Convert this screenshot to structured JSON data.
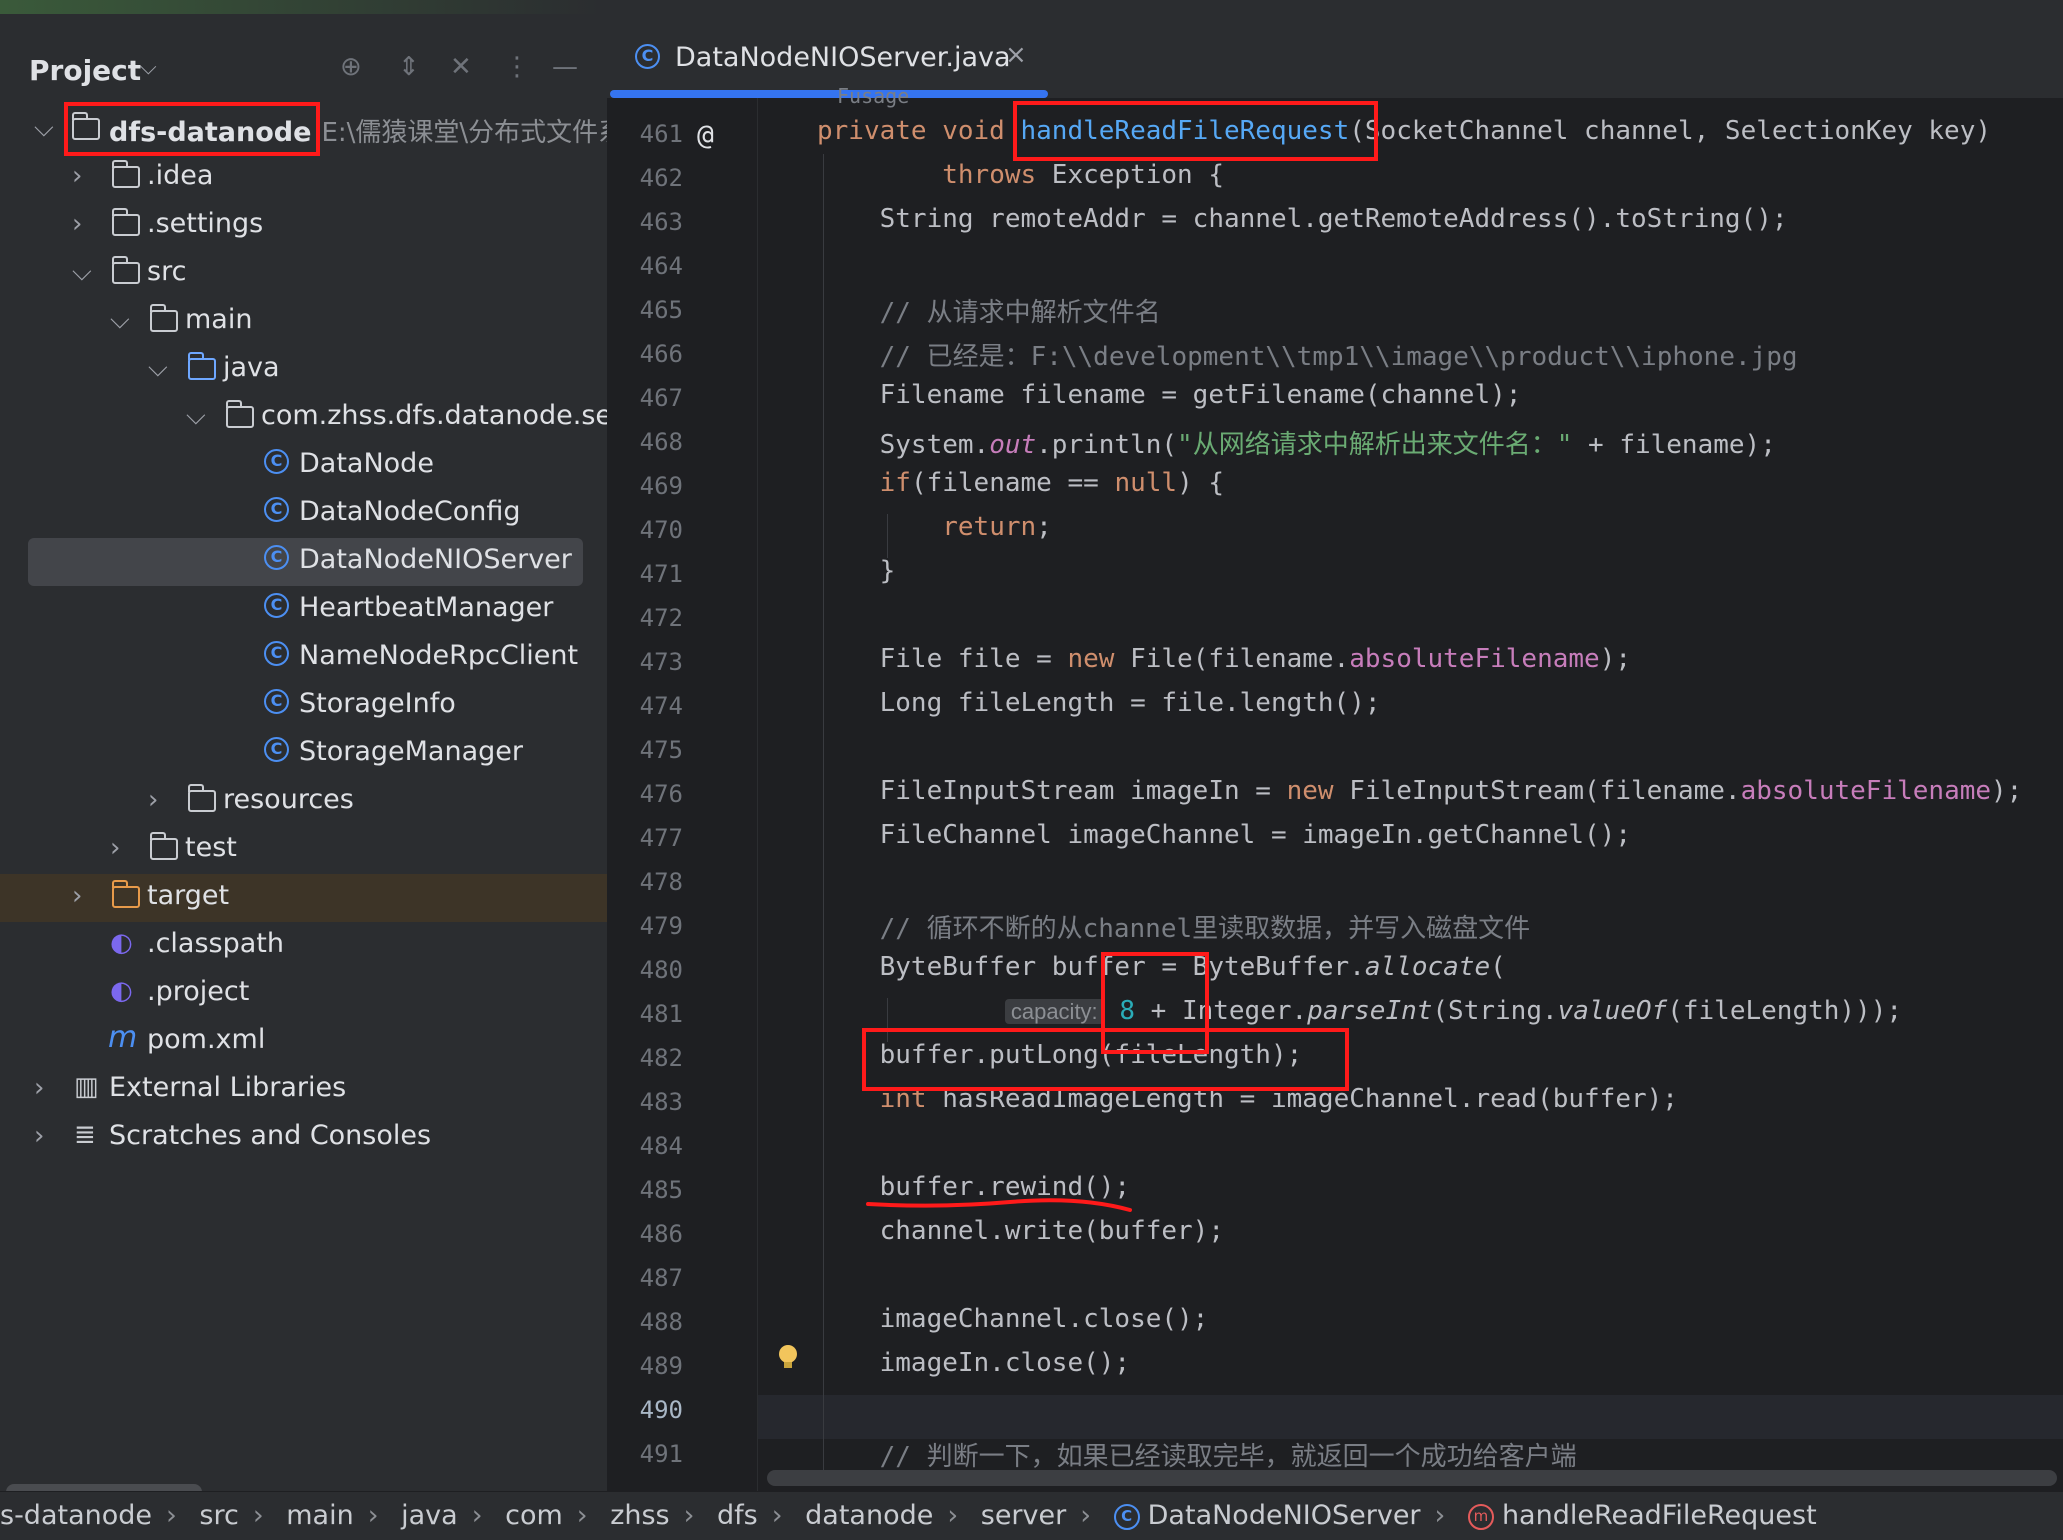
{
  "project_panel": {
    "title": "Project",
    "tree": [
      {
        "label": "dfs-datanode",
        "path": "E:\\儒猿课堂\\分布式文件系"
      },
      {
        "label": ".idea"
      },
      {
        "label": ".settings"
      },
      {
        "label": "src"
      },
      {
        "label": "main"
      },
      {
        "label": "java"
      },
      {
        "label": "com.zhss.dfs.datanode.serv"
      },
      {
        "label": "DataNode"
      },
      {
        "label": "DataNodeConfig"
      },
      {
        "label": "DataNodeNIOServer"
      },
      {
        "label": "HeartbeatManager"
      },
      {
        "label": "NameNodeRpcClient"
      },
      {
        "label": "StorageInfo"
      },
      {
        "label": "StorageManager"
      },
      {
        "label": "resources"
      },
      {
        "label": "test"
      },
      {
        "label": "target"
      },
      {
        "label": ".classpath"
      },
      {
        "label": ".project"
      },
      {
        "label": "pom.xml"
      },
      {
        "label": "External Libraries"
      },
      {
        "label": "Scratches and Consoles"
      }
    ]
  },
  "editor": {
    "tab_label": "DataNodeNIOServer.java",
    "line_numbers": [
      "461",
      "462",
      "463",
      "464",
      "465",
      "466",
      "467",
      "468",
      "469",
      "470",
      "471",
      "472",
      "473",
      "474",
      "475",
      "476",
      "477",
      "478",
      "479",
      "480",
      "481",
      "482",
      "483",
      "484",
      "485",
      "486",
      "487",
      "488",
      "489",
      "490",
      "491"
    ],
    "sticky_header": "Fusage",
    "hint_capacity": "capacity:"
  },
  "status_bar": {
    "crumbs": [
      "s-datanode",
      "src",
      "main",
      "java",
      "com",
      "zhss",
      "dfs",
      "datanode",
      "server",
      "DataNodeNIOServer",
      "handleReadFileRequest"
    ]
  },
  "colors": {
    "annotation": "#ff1a1a",
    "keyword": "#cf8e6d",
    "method": "#56a8f5",
    "comment": "#7a7e85",
    "string": "#6aab73",
    "field": "#c77dbb"
  }
}
